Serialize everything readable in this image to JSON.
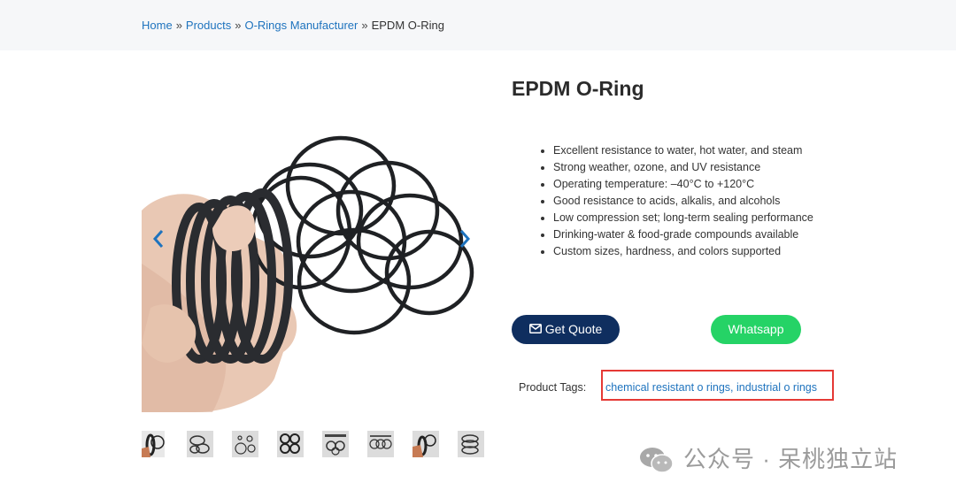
{
  "breadcrumb": {
    "items": [
      "Home",
      "Products",
      "O-Rings Manufacturer"
    ],
    "separator": "»",
    "current": "EPDM O-Ring"
  },
  "product": {
    "title": "EPDM O-Ring",
    "features": [
      "Excellent resistance to water, hot water, and steam",
      "Strong weather, ozone, and UV resistance",
      "Operating temperature: –40°C to +120°C",
      "Good resistance to acids, alkalis, and alcohols",
      "Low compression set; long-term sealing performance",
      "Drinking-water & food-grade compounds available",
      "Custom sizes, hardness, and colors supported"
    ]
  },
  "gallery": {
    "prev_icon": "chevron-left-icon",
    "next_icon": "chevron-right-icon",
    "thumbnail_count": 8
  },
  "buttons": {
    "quote_label": "Get Quote",
    "quote_icon": "envelope-icon",
    "whatsapp_label": "Whatsapp"
  },
  "tags": {
    "label": "Product Tags:",
    "links": [
      "chemical resistant o rings",
      "industrial o rings"
    ],
    "separator": ", "
  },
  "watermark": {
    "icon": "wechat-icon",
    "text": "公众号 · 呆桃独立站"
  },
  "colors": {
    "link": "#1e73be",
    "quote_button": "#0f2e5f",
    "whatsapp_button": "#25d366",
    "tag_highlight_border": "#e53935",
    "breadcrumb_bg": "#f6f7f9"
  }
}
